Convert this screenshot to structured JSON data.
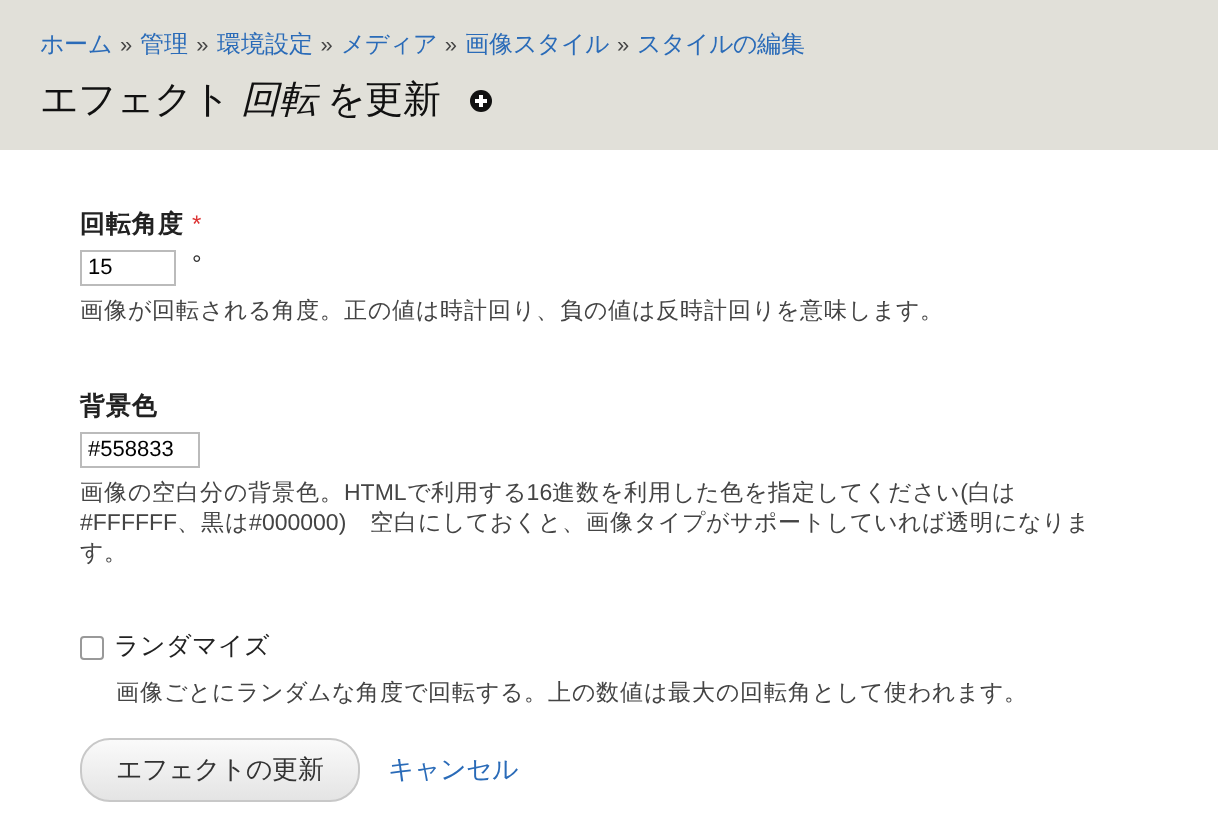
{
  "breadcrumb": {
    "separator": "»",
    "items": [
      "ホーム",
      "管理",
      "環境設定",
      "メディア",
      "画像スタイル",
      "スタイルの編集"
    ]
  },
  "title": "エフェクト *回転* を更新",
  "fields": [
    {
      "kind": "text",
      "label": "回転角度",
      "required_mark": "*",
      "value": "15",
      "suffix": "°",
      "description": "画像が回転される角度。正の値は時計回り、負の値は反時計回りを意味します。"
    },
    {
      "kind": "text",
      "label": "背景色",
      "value": "#558833",
      "description": "画像の空白分の背景色。HTMLで利用する16進数を利用した色を指定してください(白は#FFFFFF、黒は#000000)　空白にしておくと、画像タイプがサポートしていれば透明になります。"
    },
    {
      "kind": "checkbox",
      "label": "ランダマイズ",
      "checked": false,
      "description": "画像ごとにランダムな角度で回転する。上の数値は最大の回転角として使われます。"
    }
  ],
  "actions": {
    "submit": "エフェクトの更新",
    "cancel": "キャンセル"
  }
}
